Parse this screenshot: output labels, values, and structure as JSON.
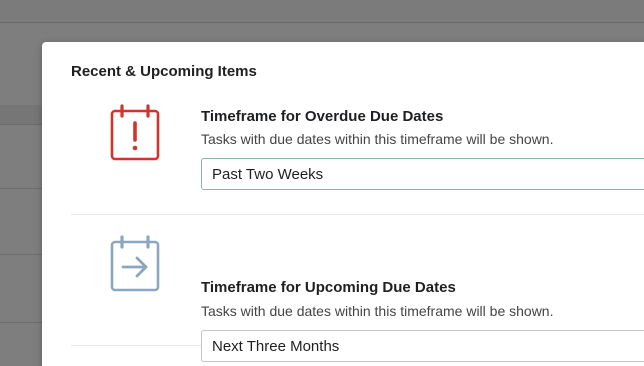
{
  "section": {
    "title": "Recent & Upcoming Items"
  },
  "overdue": {
    "label": "Timeframe for Overdue Due Dates",
    "description": "Tasks with due dates within this timeframe will be shown.",
    "selected": "Past Two Weeks",
    "icon": "calendar-exclamation-icon",
    "icon_color": "#d0352b"
  },
  "upcoming": {
    "label": "Timeframe for Upcoming Due Dates",
    "description": "Tasks with due dates within this timeframe will be shown.",
    "selected": "Next Three Months",
    "icon": "calendar-arrow-icon",
    "icon_color": "#8aa6c1"
  }
}
